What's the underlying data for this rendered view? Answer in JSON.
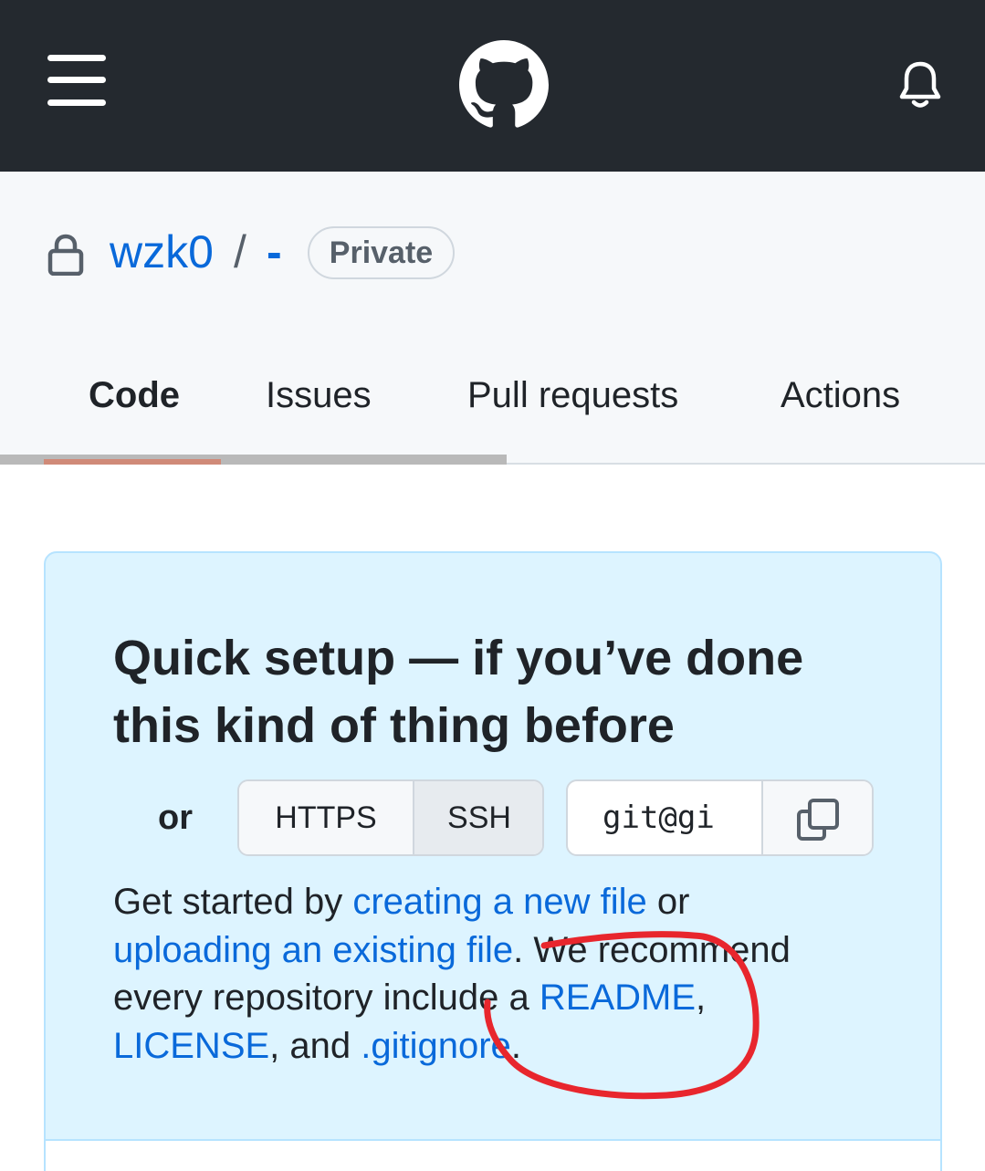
{
  "header": {
    "menu_icon": "hamburger-menu-icon",
    "logo_icon": "github-octocat-logo",
    "notifications_icon": "bell-icon"
  },
  "repo": {
    "lock_icon": "lock-icon",
    "owner": "wzk0",
    "separator": "/",
    "name": "-",
    "visibility": "Private"
  },
  "tabs": [
    {
      "label": "Code",
      "selected": true
    },
    {
      "label": "Issues"
    },
    {
      "label": "Pull requests"
    },
    {
      "label": "Actions"
    }
  ],
  "quick_setup": {
    "title": "Quick setup — if you’ve done this kind of thing before",
    "or_label": "or",
    "protocols": [
      "HTTPS",
      "SSH"
    ],
    "selected_protocol": "SSH",
    "clone_url_visible": "git@gi",
    "copy_icon": "copy-icon",
    "intro": {
      "prefix": "Get started by ",
      "link_new_file": "creating a new file",
      "or_text": " or ",
      "link_upload": "uploading an existing file",
      "middle": ". We recommend every repository include a ",
      "link_readme": "README",
      "comma": ", ",
      "link_license": "LICENSE",
      "and_text": ", and ",
      "link_gitignore": ".gitignore",
      "suffix": "."
    }
  },
  "colors": {
    "header_bg": "#24292f",
    "link": "#0969da",
    "setup_bg": "#ddf4ff",
    "annotation_stroke": "#e8262d"
  }
}
